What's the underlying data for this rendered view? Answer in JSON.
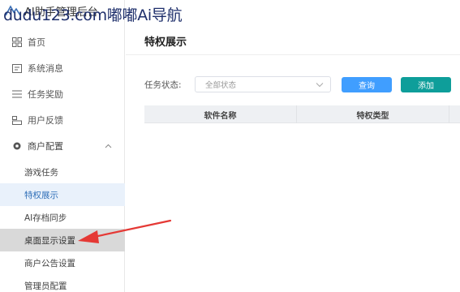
{
  "watermark": "dudu123.com嘟嘟Ai导航",
  "app": {
    "title": "AI助手管理后台"
  },
  "sidebar": {
    "items": [
      {
        "label": "首页",
        "icon": "grid-icon"
      },
      {
        "label": "系统消息",
        "icon": "message-icon"
      },
      {
        "label": "任务奖励",
        "icon": "list-icon"
      },
      {
        "label": "用户反馈",
        "icon": "feedback-icon"
      },
      {
        "label": "商户配置",
        "icon": "settings-icon",
        "expanded": true
      }
    ],
    "submenu": [
      {
        "label": "游戏任务"
      },
      {
        "label": "特权展示",
        "active": true
      },
      {
        "label": "AI存档同步"
      },
      {
        "label": "桌面显示设置",
        "highlight": true
      },
      {
        "label": "商户公告设置"
      },
      {
        "label": "管理员配置"
      }
    ]
  },
  "main": {
    "title": "特权展示",
    "filter": {
      "label": "任务状态:",
      "select_value": "全部状态"
    },
    "buttons": {
      "query": "查询",
      "add": "添加"
    },
    "table": {
      "columns": [
        "软件名称",
        "特权类型"
      ]
    }
  },
  "colors": {
    "primary": "#409eff",
    "add": "#0e9e9a",
    "active_bg": "#e9f1fb",
    "highlight_bg": "#d9d9d9",
    "annotation": "#e53935"
  }
}
